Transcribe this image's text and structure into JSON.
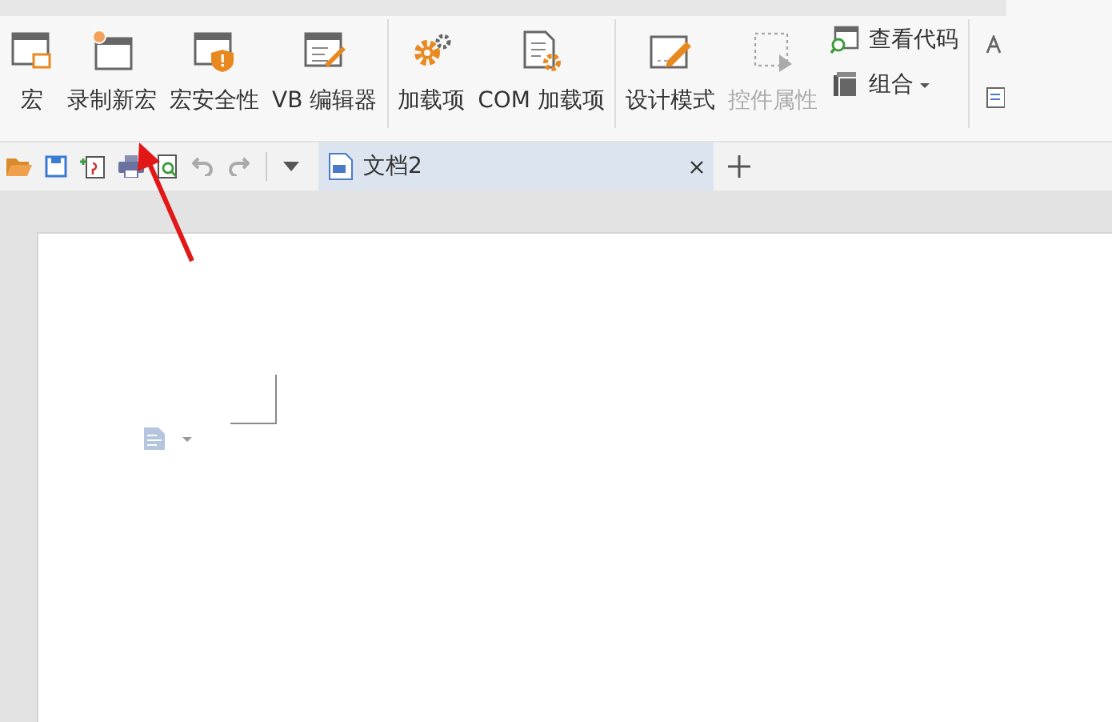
{
  "ribbon": {
    "groups": [
      {
        "buttons": [
          {
            "kind": "large",
            "label": "宏",
            "disabled": false
          },
          {
            "kind": "large",
            "label": "录制新宏",
            "disabled": false
          },
          {
            "kind": "large",
            "label": "宏安全性",
            "disabled": false
          },
          {
            "kind": "large",
            "label": "VB 编辑器",
            "disabled": false
          }
        ]
      },
      {
        "buttons": [
          {
            "kind": "large",
            "label": "加载项",
            "disabled": false
          },
          {
            "kind": "large",
            "label": "COM 加载项",
            "disabled": false
          }
        ]
      },
      {
        "buttons": [
          {
            "kind": "large",
            "label": "设计模式",
            "disabled": false
          },
          {
            "kind": "large",
            "label": "控件属性",
            "disabled": true
          },
          {
            "kind": "stack",
            "items": [
              {
                "label": "查看代码",
                "dropdown": false
              },
              {
                "label": "组合",
                "dropdown": true
              }
            ]
          }
        ]
      }
    ]
  },
  "document_tabs": [
    {
      "label": "文档2",
      "selected": true
    }
  ]
}
